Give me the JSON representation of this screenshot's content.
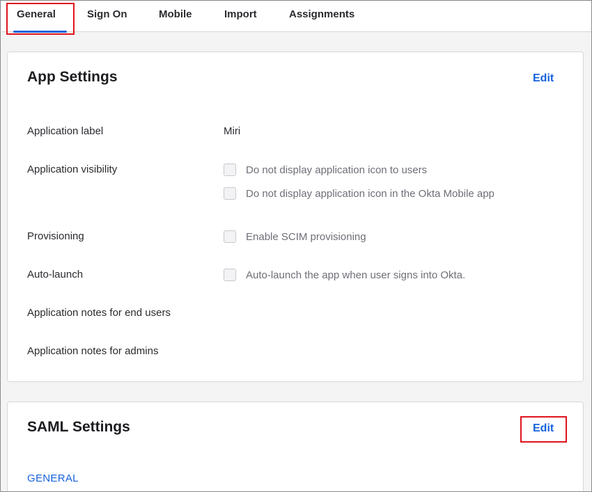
{
  "tabs": [
    {
      "label": "General",
      "active": true
    },
    {
      "label": "Sign On",
      "active": false
    },
    {
      "label": "Mobile",
      "active": false
    },
    {
      "label": "Import",
      "active": false
    },
    {
      "label": "Assignments",
      "active": false
    }
  ],
  "app_settings": {
    "title": "App Settings",
    "edit_label": "Edit",
    "application_label": {
      "label": "Application label",
      "value": "Miri"
    },
    "application_visibility": {
      "label": "Application visibility",
      "options": [
        {
          "text": "Do not display application icon to users",
          "checked": false
        },
        {
          "text": "Do not display application icon in the Okta Mobile app",
          "checked": false
        }
      ]
    },
    "provisioning": {
      "label": "Provisioning",
      "option": {
        "text": "Enable SCIM provisioning",
        "checked": false
      }
    },
    "auto_launch": {
      "label": "Auto-launch",
      "option": {
        "text": "Auto-launch the app when user signs into Okta.",
        "checked": false
      }
    },
    "notes_end_users": {
      "label": "Application notes for end users"
    },
    "notes_admins": {
      "label": "Application notes for admins"
    }
  },
  "saml_settings": {
    "title": "SAML Settings",
    "edit_label": "Edit",
    "section_link": "GENERAL"
  },
  "colors": {
    "accent": "#1662dd",
    "highlight": "#e0141e",
    "page_bg": "#f4f4f4"
  }
}
